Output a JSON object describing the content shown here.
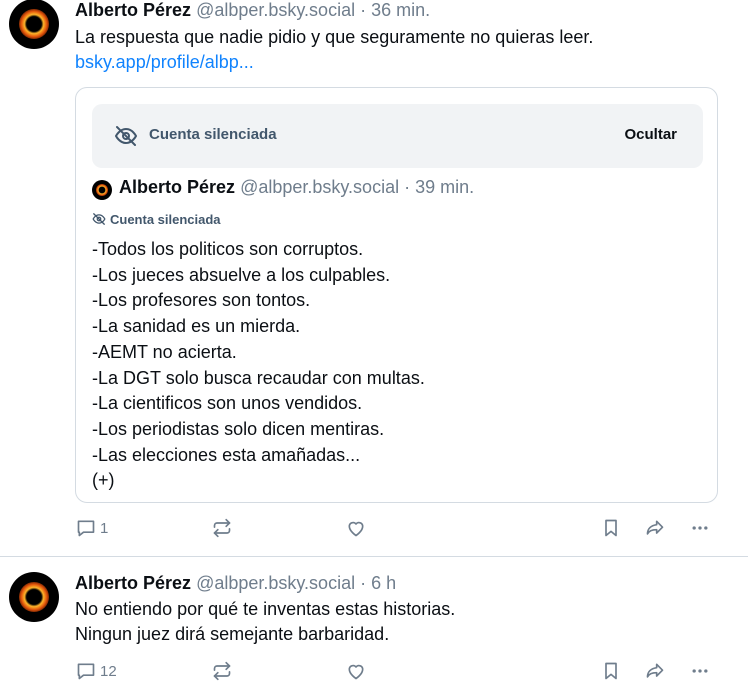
{
  "posts": [
    {
      "author": "Alberto Pérez",
      "handle": "@albper.bsky.social",
      "separator": "·",
      "time": "36 min.",
      "text": "La respuesta que nadie pidio y que seguramente no quieras leer.",
      "link": "bsky.app/profile/albp...",
      "quote": {
        "muted_label": "Cuenta silenciada",
        "hide_label": "Ocultar",
        "author": "Alberto Pérez",
        "handle": "@albper.bsky.social",
        "separator": "·",
        "time": "39 min.",
        "muted_badge": "Cuenta silenciada",
        "lines": [
          "-Todos los politicos son corruptos.",
          "-Los jueces absuelve a los culpables.",
          "-Los profesores son tontos.",
          "-La sanidad es un mierda.",
          "-AEMT no acierta.",
          "-La DGT solo busca recaudar con multas.",
          "-La cientificos son unos vendidos.",
          "-Los periodistas solo dicen mentiras.",
          "-Las elecciones esta amañadas...",
          "(+)"
        ]
      },
      "reply_count": "1",
      "icons": [
        "reply-icon",
        "repost-icon",
        "like-icon",
        "bookmark-icon",
        "share-icon",
        "more-icon"
      ]
    },
    {
      "author": "Alberto Pérez",
      "handle": "@albper.bsky.social",
      "separator": "·",
      "time": "6 h",
      "line1": "No entiendo por qué te inventas estas historias.",
      "line2": "Ningun juez dirá semejante barbaridad.",
      "reply_count": "12",
      "icons": [
        "reply-icon",
        "repost-icon",
        "like-icon",
        "bookmark-icon",
        "share-icon",
        "more-icon"
      ]
    }
  ],
  "colors": {
    "text": "#0b0f14",
    "muted": "#6f7d8c",
    "link": "#1083fe",
    "border": "#d4dbe2",
    "muted_bg": "#f1f3f5"
  }
}
